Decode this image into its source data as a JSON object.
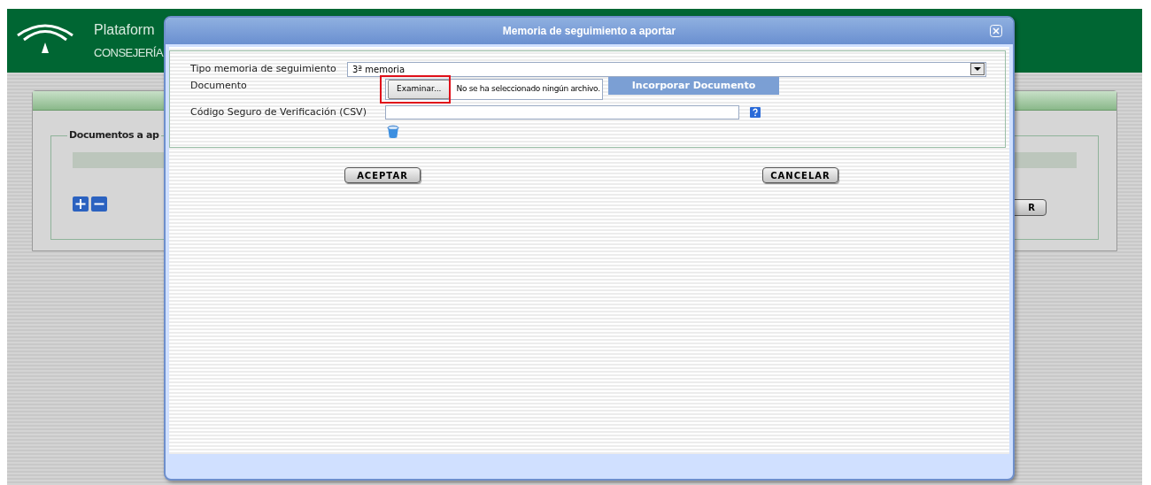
{
  "background": {
    "header": {
      "title": "Plataform",
      "subtitle": "CONSEJERÍA"
    },
    "section_title": "Documentos a ap",
    "button_fragment": "R"
  },
  "dialog": {
    "title": "Memoria de seguimiento a aportar",
    "fields": [
      {
        "kind": "select",
        "label": "Tipo memoria de seguimiento",
        "value": "3ª memoria"
      },
      {
        "kind": "file",
        "label": "Documento",
        "button": "Examinar...",
        "status": "No se ha seleccionado ningún archivo.",
        "action": "Incorporar Documento",
        "highlighted": true
      },
      {
        "kind": "text",
        "label": "Código Seguro de Verificación (CSV)"
      }
    ],
    "buttons": [
      "ACEPTAR",
      "CANCELAR"
    ]
  }
}
